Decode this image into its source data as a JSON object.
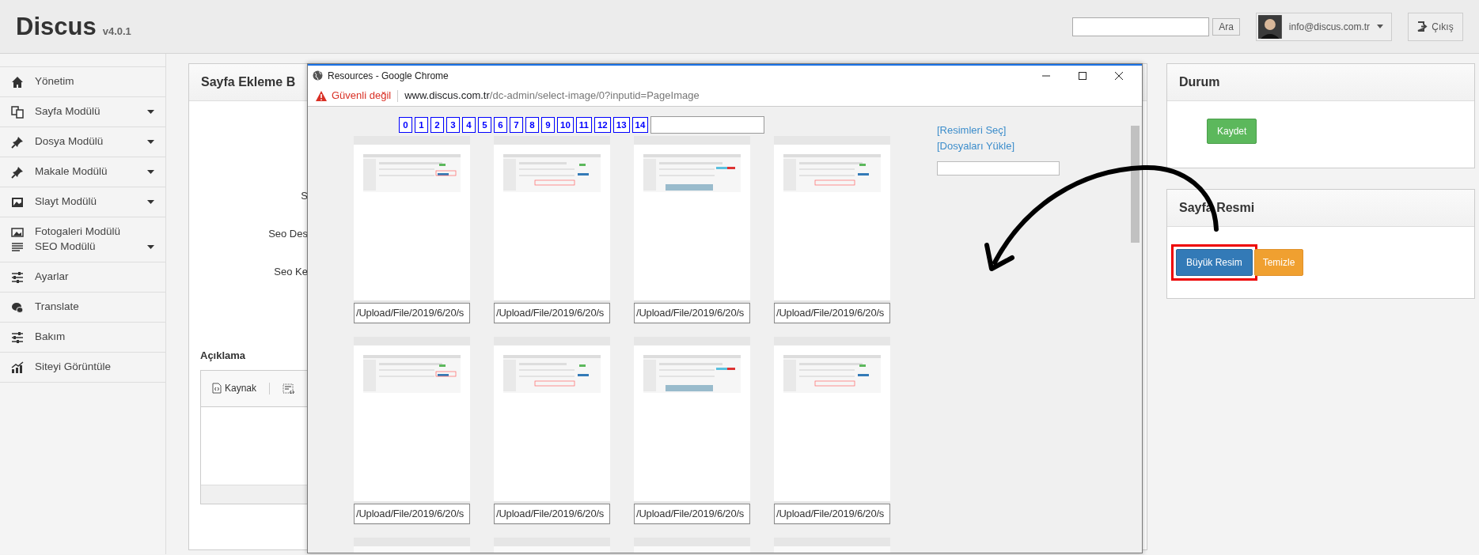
{
  "header": {
    "brand": "Discus",
    "version": "v4.0.1",
    "search_button": "Ara",
    "user_email": "info@discus.com.tr",
    "logout": "Çıkış"
  },
  "sidebar": {
    "items": [
      {
        "kind": "single",
        "label": "Yönetim",
        "submenu": false
      },
      {
        "kind": "single",
        "label": "Sayfa Modülü",
        "submenu": true
      },
      {
        "kind": "single",
        "label": "Dosya Modülü",
        "submenu": true
      },
      {
        "kind": "single",
        "label": "Makale Modülü",
        "submenu": true
      },
      {
        "kind": "single",
        "label": "Slayt Modülü",
        "submenu": true
      },
      {
        "kind": "pair",
        "lines": [
          {
            "label": "Fotogaleri Modülü",
            "submenu": false
          },
          {
            "label": "SEO Modülü",
            "submenu": true
          }
        ]
      },
      {
        "kind": "single",
        "label": "Ayarlar",
        "submenu": false
      },
      {
        "kind": "single",
        "label": "Translate",
        "submenu": false
      },
      {
        "kind": "single",
        "label": "Bakım",
        "submenu": false
      },
      {
        "kind": "single",
        "label": "Siteyi Görüntüle",
        "submenu": false
      }
    ]
  },
  "page_form": {
    "title": "Sayfa Ekleme B",
    "labels": [
      "S",
      "Seo Des",
      "Seo Ke"
    ],
    "description_label": "Açıklama",
    "editor_source_button": "Kaynak"
  },
  "popup": {
    "title": "Resources - Google Chrome",
    "security_warning": "Güvenli değil",
    "url_host": "www.discus.com.tr",
    "url_path": "/dc-admin/select-image/0?inputid=PageImage",
    "pages": [
      "0",
      "1",
      "2",
      "3",
      "4",
      "5",
      "6",
      "7",
      "8",
      "9",
      "10",
      "11",
      "12",
      "13",
      "14"
    ],
    "links": [
      "[Resimleri Seç]",
      "[Dosyaları Yükle]"
    ],
    "thumbnails": [
      {
        "kind": "full",
        "path": "/Upload/File/2019/6/20/s"
      },
      {
        "kind": "full",
        "path": "/Upload/File/2019/6/20/s"
      },
      {
        "kind": "full",
        "path": "/Upload/File/2019/6/20/s"
      },
      {
        "kind": "full",
        "path": "/Upload/File/2019/6/20/s"
      },
      {
        "kind": "full",
        "path": "/Upload/File/2019/6/20/s"
      },
      {
        "kind": "full",
        "path": "/Upload/File/2019/6/20/s"
      },
      {
        "kind": "full",
        "path": "/Upload/File/2019/6/20/s"
      },
      {
        "kind": "full",
        "path": "/Upload/File/2019/6/20/s"
      },
      {
        "kind": "partial"
      },
      {
        "kind": "partial"
      },
      {
        "kind": "partial"
      },
      {
        "kind": "partial"
      }
    ]
  },
  "status_panel": {
    "title": "Durum",
    "save_button": "Kaydet"
  },
  "image_panel": {
    "title": "Sayfa Resmi",
    "buttons": [
      {
        "label": "Büyük Resim",
        "kind": "primary",
        "highlighted": true
      },
      {
        "label": "Temizle",
        "kind": "warning",
        "highlighted": false
      }
    ]
  }
}
